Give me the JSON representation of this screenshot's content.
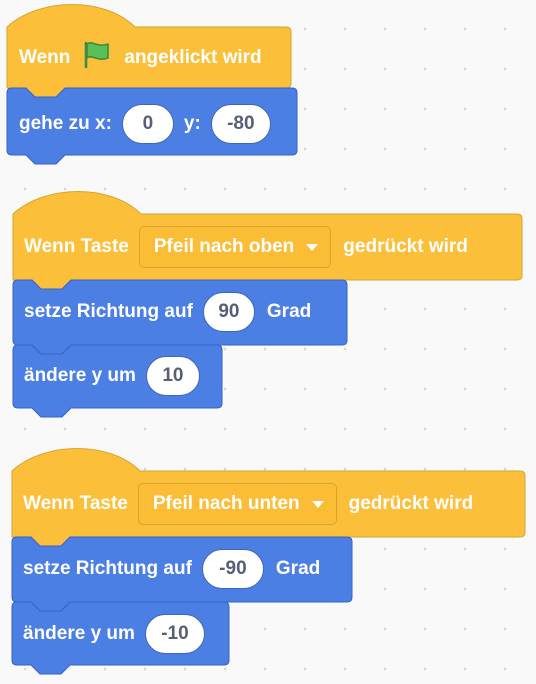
{
  "colors": {
    "events_fill": "#fcbf3a",
    "events_stroke": "#d4a531",
    "motion_fill": "#4c7fe4",
    "motion_stroke": "#3563c3",
    "canvas_bg": "#f9f9f9",
    "input_text": "#575e75",
    "flag_green": "#59c059"
  },
  "scripts": [
    {
      "hat": {
        "type": "flag",
        "label_before": "Wenn",
        "icon": "green-flag-icon",
        "label_after": "angeklickt wird"
      },
      "blocks": [
        {
          "type": "goto_xy",
          "label": "gehe zu x:",
          "x_value": "0",
          "y_label": "y:",
          "y_value": "-80"
        }
      ]
    },
    {
      "hat": {
        "type": "key",
        "label_before": "Wenn Taste",
        "key": "Pfeil nach oben",
        "label_after": "gedrückt wird"
      },
      "blocks": [
        {
          "type": "point_direction",
          "label": "setze Richtung auf",
          "value": "90",
          "unit": "Grad"
        },
        {
          "type": "change_y",
          "label": "ändere y um",
          "value": "10"
        }
      ]
    },
    {
      "hat": {
        "type": "key",
        "label_before": "Wenn Taste",
        "key": "Pfeil nach unten",
        "label_after": "gedrückt wird"
      },
      "blocks": [
        {
          "type": "point_direction",
          "label": "setze Richtung auf",
          "value": "-90",
          "unit": "Grad"
        },
        {
          "type": "change_y",
          "label": "ändere y um",
          "value": "-10"
        }
      ]
    }
  ]
}
